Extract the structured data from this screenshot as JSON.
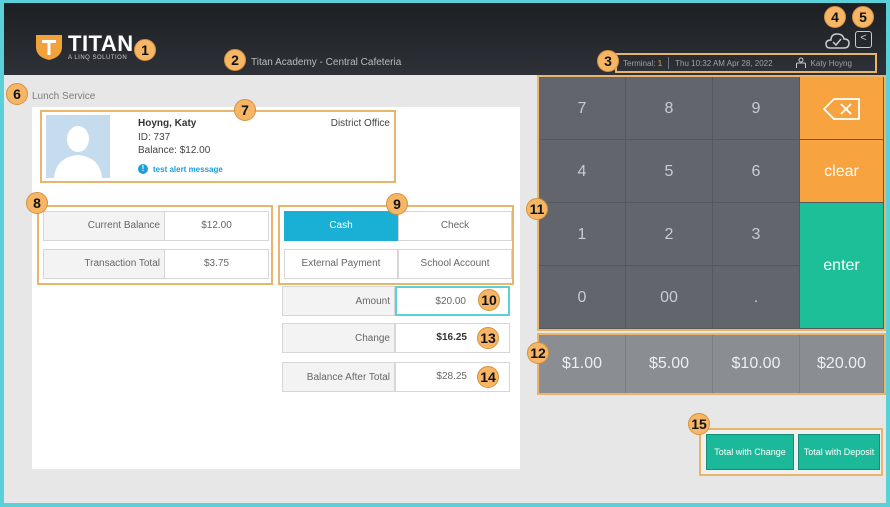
{
  "header": {
    "logo_title": "TITAN",
    "logo_subtitle": "A LINQ SOLUTION",
    "school_name": "Titan Academy - Central Cafeteria",
    "terminal_label": "Terminal:",
    "terminal_number": "1",
    "datetime": "Thu 10:32 AM Apr 28, 2022",
    "user_name": "Katy Hoyng",
    "back_glyph": "<"
  },
  "service": {
    "label": "Lunch Service"
  },
  "student": {
    "name": "Hoyng, Katy",
    "id": "ID: 737",
    "balance": "Balance: $12.00",
    "location": "District Office",
    "alert": "test alert message",
    "alert_glyph": "!"
  },
  "balances": {
    "current_label": "Current Balance",
    "current_value": "$12.00",
    "transaction_label": "Transaction Total",
    "transaction_value": "$3.75"
  },
  "payment": {
    "cash": "Cash",
    "check": "Check",
    "external": "External Payment",
    "school_account": "School Account",
    "selected": "Cash"
  },
  "calc": {
    "amount_label": "Amount",
    "amount_value": "$20.00",
    "change_label": "Change",
    "change_value": "$16.25",
    "after_label": "Balance After Total",
    "after_value": "$28.25"
  },
  "keypad": {
    "k7": "7",
    "k8": "8",
    "k9": "9",
    "k4": "4",
    "k5": "5",
    "k6": "6",
    "k1": "1",
    "k2": "2",
    "k3": "3",
    "k0": "0",
    "k00": "00",
    "kdot": ".",
    "clear": "clear",
    "enter": "enter"
  },
  "quick_amounts": {
    "q1": "$1.00",
    "q5": "$5.00",
    "q10": "$10.00",
    "q20": "$20.00"
  },
  "actions": {
    "total_change": "Total with Change",
    "total_deposit": "Total with Deposit"
  },
  "badges": {
    "b1": "1",
    "b2": "2",
    "b3": "3",
    "b4": "4",
    "b5": "5",
    "b6": "6",
    "b7": "7",
    "b8": "8",
    "b9": "9",
    "b10": "10",
    "b11": "11",
    "b12": "12",
    "b13": "13",
    "b14": "14",
    "b15": "15"
  },
  "icons": {
    "logo": "shield-icon",
    "cloud": "cloud-check-icon",
    "back": "chevron-left-icon",
    "user": "user-icon",
    "backspace": "backspace-icon",
    "alert": "alert-icon",
    "avatar": "avatar-silhouette-icon"
  },
  "colors": {
    "accent": "#1ab0d6",
    "teal": "#1cbf98",
    "orange": "#f7a340",
    "annotation": "#f7b665"
  }
}
